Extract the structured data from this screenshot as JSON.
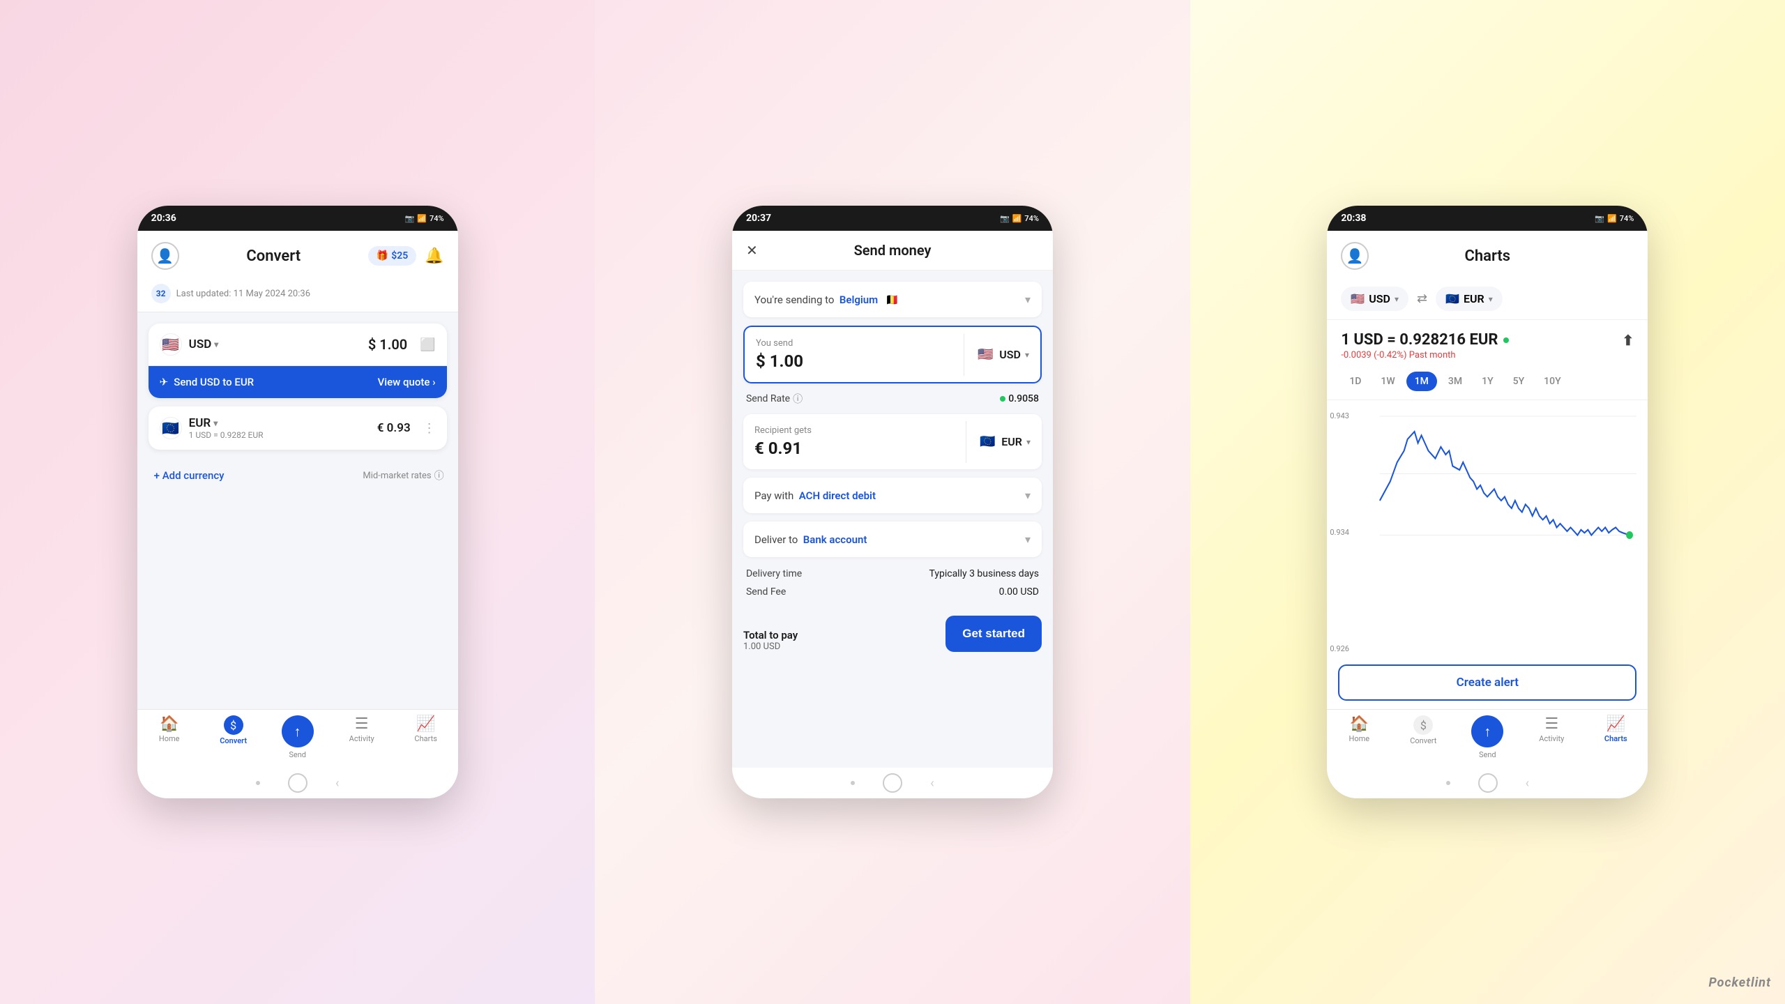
{
  "screen1": {
    "statusBar": {
      "time": "20:36",
      "battery": "74%"
    },
    "header": {
      "title": "Convert",
      "gift": "$25",
      "giftIcon": "🎁",
      "bellIcon": "🔔"
    },
    "updateBadge": "32",
    "updateText": "Last updated: 11 May 2024 20:36",
    "fromCurrency": {
      "flag": "🇺🇸",
      "code": "USD",
      "amount": "$ 1.00"
    },
    "sendButton": {
      "label": "Send USD to EUR",
      "viewQuote": "View quote ›"
    },
    "toCurrency": {
      "flag": "🇪🇺",
      "code": "EUR",
      "amount": "€ 0.93",
      "rate": "1 USD = 0.9282 EUR"
    },
    "addCurrency": "+ Add currency",
    "midMarket": "Mid-market rates",
    "bottomNav": {
      "home": "Home",
      "convert": "Convert",
      "send": "Send",
      "activity": "Activity",
      "charts": "Charts"
    }
  },
  "screen2": {
    "statusBar": {
      "time": "20:37",
      "battery": "74%"
    },
    "title": "Send money",
    "sendingTo": "You're sending to",
    "country": "Belgium",
    "youSend": "You send",
    "sendAmount": "$ 1.00",
    "sendCurrency": "USD",
    "sendRate": "Send Rate",
    "rateValue": "0.9058",
    "recipientGets": "Recipient gets",
    "recipientAmount": "€ 0.91",
    "recipientCurrency": "EUR",
    "payWith": "Pay with",
    "payMethod": "ACH direct debit",
    "deliverTo": "Deliver to",
    "deliverMethod": "Bank account",
    "deliveryTime": "Delivery time",
    "deliveryValue": "Typically 3 business days",
    "sendFee": "Send Fee",
    "feeValue": "0.00 USD",
    "totalToPay": "Total to pay",
    "totalValue": "1.00 USD",
    "getStarted": "Get started",
    "bottomNav": {
      "home": "Home",
      "convert": "Convert",
      "send": "Send",
      "activity": "Activity",
      "charts": "Charts"
    }
  },
  "screen3": {
    "statusBar": {
      "time": "20:38",
      "battery": "74%"
    },
    "title": "Charts",
    "fromCurrency": "USD",
    "toCurrency": "EUR",
    "rateMain": "1 USD = 0.928216 EUR",
    "rateChange": "-0.0039 (-0.42%) Past month",
    "timeTabs": [
      "1D",
      "1W",
      "1M",
      "3M",
      "1Y",
      "5Y",
      "10Y"
    ],
    "activeTab": "1M",
    "chartLabels": [
      "0.943",
      "0.934",
      "0.926"
    ],
    "createAlert": "Create alert",
    "bottomNav": {
      "home": "Home",
      "convert": "Convert",
      "send": "Send",
      "activity": "Activity",
      "charts": "Charts"
    }
  },
  "pocketlint": "Pocketlint"
}
